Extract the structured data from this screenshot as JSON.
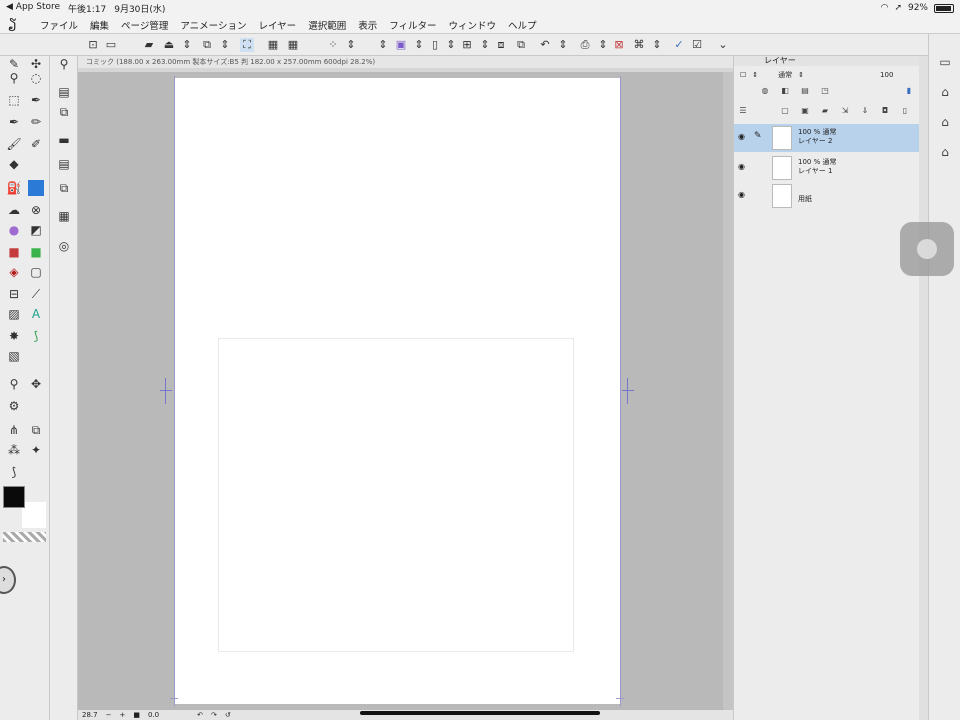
{
  "status_bar": {
    "back_app": "◀ App Store",
    "time": "午後1:17",
    "date": "9月30日(水)",
    "battery": "92%",
    "battery_level": 0.92
  },
  "menu": {
    "items": [
      "ファイル",
      "編集",
      "ページ管理",
      "アニメーション",
      "レイヤー",
      "選択範囲",
      "表示",
      "フィルター",
      "ウィンドウ",
      "ヘルプ"
    ]
  },
  "canvas": {
    "header": "コミック (188.00 x 263.00mm 製本サイズ:B5 判 182.00 x 257.00mm 600dpi 28.2%)"
  },
  "bottom_bar": {
    "zoom": "28.7",
    "rotation": "0.0"
  },
  "layer_panel": {
    "title": "レイヤー",
    "blend_mode": "通常",
    "opacity": "100",
    "layers": [
      {
        "opacity_mode": "100 %  通常",
        "name": "レイヤー 2",
        "selected": true
      },
      {
        "opacity_mode": "100 %  通常",
        "name": "レイヤー 1",
        "selected": false
      },
      {
        "opacity_mode": "",
        "name": "用紙",
        "selected": false
      }
    ]
  },
  "colors": {
    "main": "#0a0a0a",
    "sub": "#ffffff",
    "selection": "#b9d2ec"
  }
}
